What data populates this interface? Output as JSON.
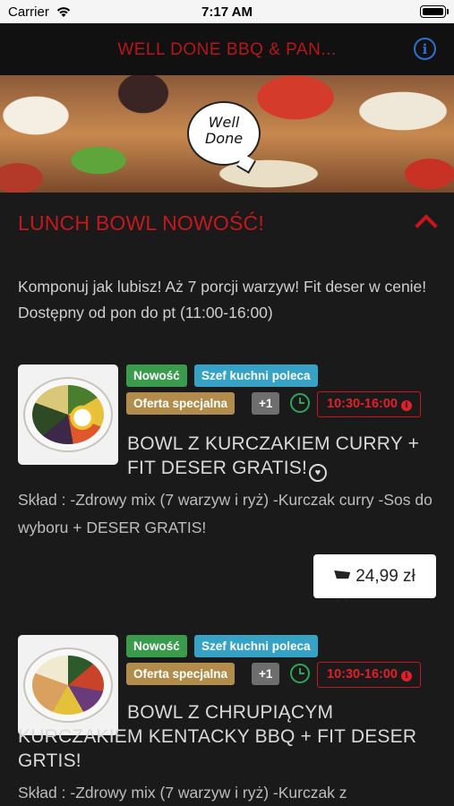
{
  "status_bar": {
    "carrier": "Carrier",
    "time": "7:17 AM"
  },
  "nav": {
    "title": "WELL DONE BBQ & PAN..."
  },
  "banner": {
    "logo_line1": "Well",
    "logo_line2": "Done"
  },
  "section": {
    "title": "LUNCH BOWL NOWOŚĆ!",
    "description": "Komponuj jak lubisz! Aż 7 porcji warzyw! Fit deser w cenie! Dostępny od pon do pt (11:00-16:00)"
  },
  "items": [
    {
      "tags": [
        "Nowość",
        "Szef kuchni poleca",
        "Oferta specjalna",
        "+1"
      ],
      "hours": "10:30-16:00",
      "name": "BOWL Z KURCZAKIEM CURRY + FIT DESER GRATIS!",
      "description": "Skład : -Zdrowy mix (7 warzyw i ryż) -Kurczak curry -Sos do wyboru + DESER GRATIS!",
      "price": "24,99 zł"
    },
    {
      "tags": [
        "Nowość",
        "Szef kuchni poleca",
        "Oferta specjalna",
        "+1"
      ],
      "hours": "10:30-16:00",
      "name": "BOWL Z CHRUPIĄCYM KURCZAKIEM KENTACKY BBQ + FIT DESER GRTIS!",
      "description": "Skład : -Zdrowy mix (7 warzyw i ryż) -Kurczak z"
    }
  ],
  "colors": {
    "accent_red": "#c8171c",
    "tag_new": "#3a9b4d",
    "tag_chef": "#35a2c6",
    "tag_offer": "#b28c4a",
    "info_blue": "#2f6fd1"
  }
}
